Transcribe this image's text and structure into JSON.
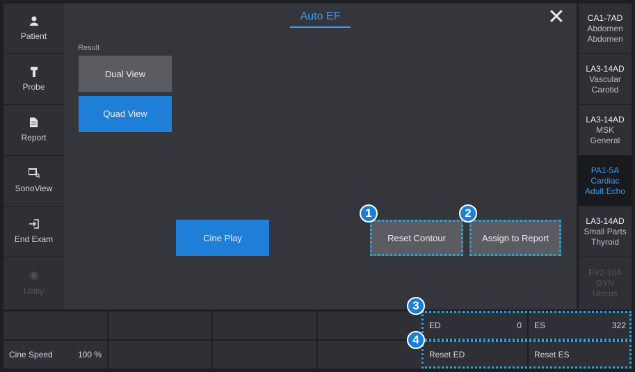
{
  "left_nav": [
    {
      "label": "Patient",
      "icon": "person-icon",
      "enabled": true
    },
    {
      "label": "Probe",
      "icon": "probe-icon",
      "enabled": true
    },
    {
      "label": "Report",
      "icon": "document-icon",
      "enabled": true
    },
    {
      "label": "SonoView",
      "icon": "sonoview-icon",
      "enabled": true
    },
    {
      "label": "End Exam",
      "icon": "exit-icon",
      "enabled": true
    },
    {
      "label": "Utility",
      "icon": "gear-icon",
      "enabled": false
    }
  ],
  "main": {
    "title": "Auto EF",
    "result_label": "Result",
    "dual_view": "Dual View",
    "quad_view": "Quad View",
    "cine_play": "Cine Play",
    "reset_contour": "Reset Contour",
    "assign_to_report": "Assign to Report"
  },
  "probes": [
    {
      "name": "CA1-7AD",
      "line1": "Abdomen",
      "line2": "Abdomen",
      "state": "normal"
    },
    {
      "name": "LA3-14AD",
      "line1": "Vascular",
      "line2": "Carotid",
      "state": "normal"
    },
    {
      "name": "LA3-14AD",
      "line1": "MSK",
      "line2": "General",
      "state": "normal"
    },
    {
      "name": "PA1-5A",
      "line1": "Cardiac",
      "line2": "Adult Echo",
      "state": "selected"
    },
    {
      "name": "LA3-14AD",
      "line1": "Small Parts",
      "line2": "Thyroid",
      "state": "normal"
    },
    {
      "name": "EV2-10A",
      "line1": "GYN",
      "line2": "Uterus",
      "state": "disabled"
    }
  ],
  "bottom": {
    "cine_speed_label": "Cine Speed",
    "cine_speed_value": "100 %",
    "ed_label": "ED",
    "ed_value": "0",
    "es_label": "ES",
    "es_value": "322",
    "reset_ed": "Reset ED",
    "reset_es": "Reset ES"
  },
  "callouts": [
    "1",
    "2",
    "3",
    "4"
  ],
  "colors": {
    "accent": "#1f7ed8",
    "callout_border": "#1aa6e8",
    "title": "#3d9bf0"
  }
}
